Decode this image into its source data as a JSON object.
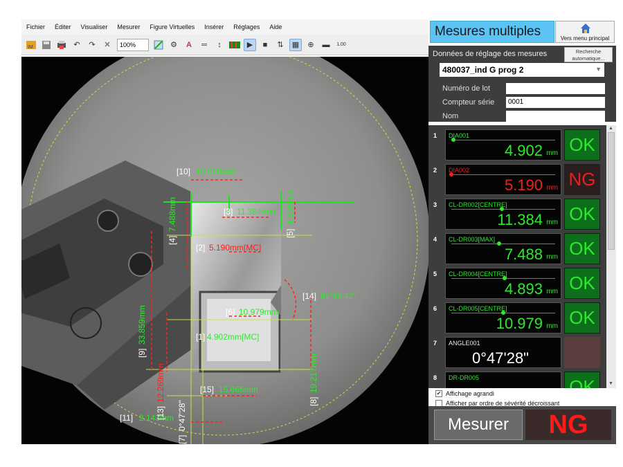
{
  "menu": [
    "Fichier",
    "Éditer",
    "Visualiser",
    "Mesurer",
    "Figure Virtuelles",
    "Insérer",
    "Réglages",
    "Aide"
  ],
  "toolbar": {
    "zoom": "100%"
  },
  "view_labels": [
    {
      "tag": "[1]",
      "text": "4.902mm[MC]",
      "color": "#2fe82f"
    },
    {
      "tag": "[2]",
      "text": "5.190mm[MC]",
      "color": "#ff2020"
    },
    {
      "tag": "[3]",
      "text": "11.384mm",
      "color": "#2fe82f"
    },
    {
      "tag": "[4]",
      "text": "7.488mm",
      "color": "#2fe82f"
    },
    {
      "tag": "[5]",
      "text": "4.893mm",
      "color": "#2fe82f"
    },
    {
      "tag": "[6]",
      "text": "10.979mm",
      "color": "#2fe82f"
    },
    {
      "tag": "[7]",
      "text": "0°47'28\"",
      "color": "#ffffff"
    },
    {
      "tag": "[8]",
      "text": "19.217mm",
      "color": "#2fe82f"
    },
    {
      "tag": "[9]",
      "text": "33.859mm",
      "color": "#2fe82f"
    },
    {
      "tag": "[10]",
      "text": "10.080mm",
      "color": "#2fe82f"
    },
    {
      "tag": "[11]",
      "text": "2.143mm",
      "color": "#2fe82f"
    },
    {
      "tag": "[13]",
      "text": "12.269mm",
      "color": "#2fe82f"
    },
    {
      "tag": "[14]",
      "text": "91°58'42\"",
      "color": "#2fe82f"
    },
    {
      "tag": "[15]",
      "text": "15.666mm",
      "color": "#2fe82f"
    }
  ],
  "panel": {
    "title": "Mesures multiples",
    "home_label": "Vers menu principal",
    "settings_label": "Données de réglage des mesures",
    "search_button": "Recherche automatique...",
    "program": "480037_ind G prog 2",
    "fields": [
      {
        "label": "Numéro de lot",
        "value": ""
      },
      {
        "label": "Compteur série",
        "value": "0001"
      },
      {
        "label": "Nom",
        "value": ""
      }
    ]
  },
  "measurements": [
    {
      "num": "1",
      "name": "DIA001",
      "value": "4.902",
      "unit": "mm",
      "judge": "OK",
      "state": "ok"
    },
    {
      "num": "2",
      "name": "DIA002",
      "value": "5.190",
      "unit": "mm",
      "judge": "NG",
      "state": "ng"
    },
    {
      "num": "3",
      "name": "CL-DR002[CENTRE]",
      "value": "11.384",
      "unit": "mm",
      "judge": "OK",
      "state": "ok"
    },
    {
      "num": "4",
      "name": "CL-DR003[MAX]",
      "value": "7.488",
      "unit": "mm",
      "judge": "OK",
      "state": "ok"
    },
    {
      "num": "5",
      "name": "CL-DR004[CENTRE]",
      "value": "4.893",
      "unit": "mm",
      "judge": "OK",
      "state": "ok"
    },
    {
      "num": "6",
      "name": "CL-DR005[CENTRE]",
      "value": "10.979",
      "unit": "mm",
      "judge": "OK",
      "state": "ok"
    },
    {
      "num": "7",
      "name": "ANGLE001",
      "value": "0°47'28\"",
      "unit": "",
      "judge": "",
      "state": "angle"
    },
    {
      "num": "8",
      "name": "DR-DR005",
      "value": "",
      "unit": "",
      "judge": "OK",
      "state": "ok"
    }
  ],
  "options": [
    {
      "label": "Affichage agrandi",
      "checked": true
    },
    {
      "label": "Afficher par ordre de sévérité décroissant",
      "checked": false
    }
  ],
  "bottom": {
    "measure_button": "Mesurer",
    "result": "NG"
  },
  "colors": {
    "ok": "#2fe82f",
    "ng": "#f01d1d",
    "header": "#5cc4f5"
  }
}
